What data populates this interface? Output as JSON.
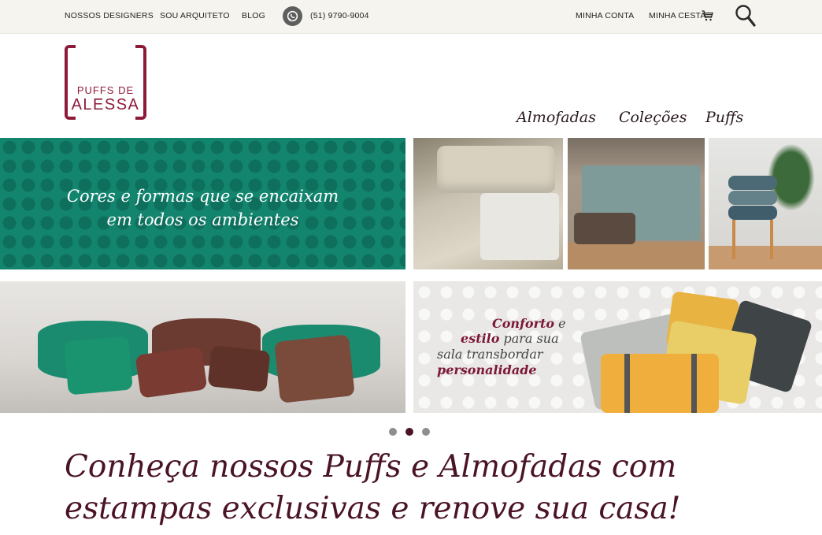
{
  "topbar": {
    "links": [
      "NOSSOS DESIGNERS",
      "SOU ARQUITETO",
      "BLOG"
    ],
    "phone": "(51) 9790-9004",
    "account": "MINHA CONTA",
    "cart": "MINHA CESTA"
  },
  "logo": {
    "line1": "PUFFS DE",
    "line2": "ALESSA"
  },
  "nav": [
    "Almofadas",
    "Coleções",
    "Puffs"
  ],
  "banners": {
    "b1": {
      "line1": "Cores e formas que se encaixam",
      "line2": "em todos os ambientes"
    },
    "b4": {
      "l1_em": "Conforto",
      "l1": " e",
      "l2_em": "estilo",
      "l2": " para sua",
      "l3": "sala transbordar",
      "l4_em": "personalidade"
    }
  },
  "slider": {
    "dots": 3,
    "active": 2
  },
  "headline": {
    "line1": "Conheça nossos Puffs e Almofadas com",
    "line2": "estampas exclusivas e renove sua casa!"
  },
  "colors": {
    "brand": "#8e1a3a",
    "headline": "#4a1424",
    "topbar": "#f6f4ee",
    "teal": "#13856f"
  }
}
